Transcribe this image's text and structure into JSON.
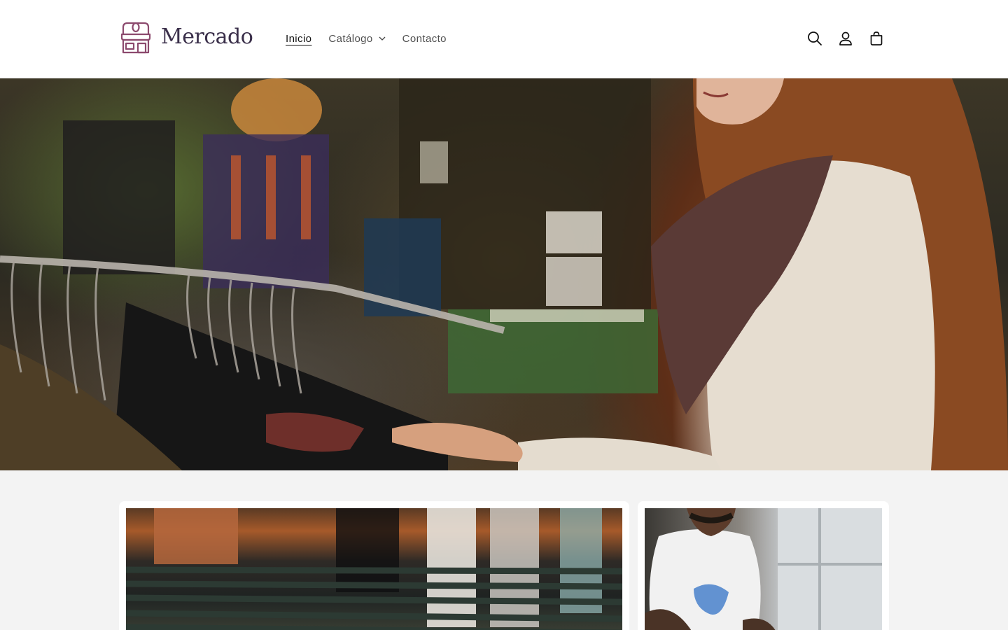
{
  "header": {
    "logo_text": "Mercado",
    "nav": [
      {
        "label": "Inicio",
        "active": true
      },
      {
        "label": "Catálogo",
        "has_dropdown": true
      },
      {
        "label": "Contacto"
      }
    ],
    "icons": [
      "search-icon",
      "account-icon",
      "cart-icon"
    ]
  },
  "hero": {
    "image": "woman-browsing-clothing-rack"
  },
  "collections": [
    {
      "image": "clothing-racks-store"
    },
    {
      "image": "man-white-tshirt"
    }
  ],
  "colors": {
    "logo_accent": "#8c4a6e",
    "text": "#121212",
    "section_bg": "#f3f3f3"
  }
}
